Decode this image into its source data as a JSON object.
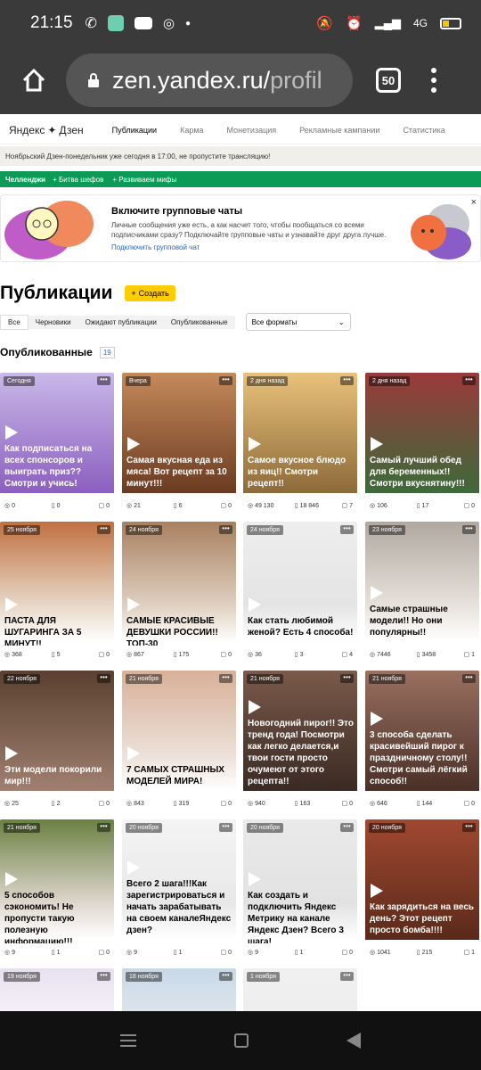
{
  "status": {
    "time": "21:15",
    "network": "4G"
  },
  "browser": {
    "url_main": "zen.yandex.ru/",
    "url_dim": "profil",
    "tabs_count": "50"
  },
  "header": {
    "logo": {
      "left": "Яндекс",
      "right": "Дзен"
    },
    "nav": [
      "Публикации",
      "Карма",
      "Монетизация",
      "Рекламные кампании",
      "Статистика"
    ]
  },
  "announce": "Ноябрьский Дзен-понедельник уже сегодня в 17:00, не пропустите трансляцию!",
  "greenbar": {
    "title": "Челленджи",
    "items": [
      "+ Битва шефов",
      "+ Развиваем мифы"
    ]
  },
  "promo": {
    "title": "Включите групповые чаты",
    "text": "Личные сообщения уже есть, а как насчет того, чтобы пообщаться со всеми подписчиками сразу? Подключайте групповые чаты и узнавайте друг друга лучше.",
    "link": "Подключить групповой чат",
    "close": "×"
  },
  "publications": {
    "title": "Публикации",
    "create": "Создать",
    "filters": [
      "Все",
      "Черновики",
      "Ожидают публикации",
      "Опубликованные"
    ],
    "format": "Все форматы",
    "published_label": "Опубликованные",
    "published_count": "19"
  },
  "cards": [
    {
      "date": "Сегодня",
      "title": "Как подписаться на всех спонсоров и выиграть приз?? Смотри и учись!",
      "views": "0",
      "reads": "0",
      "comments": "0",
      "dark": true,
      "color1": "#c9b8e8",
      "color2": "#8c5fbf"
    },
    {
      "date": "Вчера",
      "title": "Самая вкусная еда из мяса! Вот рецепт за 10 минут!!!",
      "views": "21",
      "reads": "6",
      "comments": "0",
      "dark": true,
      "color1": "#c58a5a",
      "color2": "#6b3b22"
    },
    {
      "date": "2 дня назад",
      "title": "Самое вкусное блюдо из яиц!! Смотри рецепт!!",
      "views": "49 130",
      "reads": "18 846",
      "comments": "7",
      "dark": true,
      "color1": "#e9c27a",
      "color2": "#8d6a3a"
    },
    {
      "date": "2 дня назад",
      "title": "Самый лучший обед для беременных!! Смотри вкуснятину!!!",
      "views": "106",
      "reads": "17",
      "comments": "0",
      "dark": true,
      "color1": "#9a3a3a",
      "color2": "#3d6a3a"
    },
    {
      "date": "25 ноября",
      "title": "ПАСТА ДЛЯ ШУГАРИНГА ЗА 5 МИНУТ!!",
      "views": "368",
      "reads": "5",
      "comments": "0",
      "dark": false,
      "color1": "#c07040",
      "color2": "#e8d8c8"
    },
    {
      "date": "24 ноября",
      "title": "САМЫЕ КРАСИВЫЕ ДЕВУШКИ РОССИИ!! ТОП-30",
      "views": "867",
      "reads": "175",
      "comments": "0",
      "dark": false,
      "color1": "#a88060",
      "color2": "#e0d0c0"
    },
    {
      "date": "24 ноября",
      "title": "Как стать любимой женой? Есть 4 способа!",
      "views": "36",
      "reads": "3",
      "comments": "4",
      "dark": false,
      "color1": "#eeeeee",
      "color2": "#e4e4e4"
    },
    {
      "date": "23 ноября",
      "title": "Самые страшные модели!! Но они популярны!!",
      "views": "7446",
      "reads": "3458",
      "comments": "1",
      "dark": false,
      "color1": "#b0a8a0",
      "color2": "#e8e2dc"
    },
    {
      "date": "22 ноября",
      "title": "Эти модели покорили мир!!!",
      "views": "25",
      "reads": "2",
      "comments": "0",
      "dark": true,
      "color1": "#5a4030",
      "color2": "#a08070"
    },
    {
      "date": "21 ноября",
      "title": "7 САМЫХ СТРАШНЫХ МОДЕЛЕЙ МИРА!",
      "views": "843",
      "reads": "319",
      "comments": "0",
      "dark": false,
      "color1": "#d8b098",
      "color2": "#ece0d8"
    },
    {
      "date": "21 ноября",
      "title": "Новогодний пирог!! Это тренд года! Посмотри как легко делается,и твои гости просто очумеют от этого рецепта!!",
      "views": "940",
      "reads": "163",
      "comments": "0",
      "dark": true,
      "color1": "#7a5a4a",
      "color2": "#3a2a24"
    },
    {
      "date": "21 ноября",
      "title": "3 способа сделать красивейший пирог к праздничному столу!! Смотри самый лёгкий способ!!",
      "views": "646",
      "reads": "144",
      "comments": "0",
      "dark": true,
      "color1": "#9a7060",
      "color2": "#4a3028"
    },
    {
      "date": "21 ноября",
      "title": "5 способов сэкономить! Не пропусти такую полезную информацию!!!",
      "views": "9",
      "reads": "1",
      "comments": "0",
      "dark": false,
      "color1": "#6a8040",
      "color2": "#e0d8d0"
    },
    {
      "date": "20 ноября",
      "title": "Всего 2 шага!!!Как зарегистрироваться и начать зарабатывать на своем каналеЯндекс дзен?",
      "views": "9",
      "reads": "1",
      "comments": "0",
      "dark": false,
      "color1": "#f4f4f4",
      "color2": "#e8e8e8"
    },
    {
      "date": "20 ноября",
      "title": "Как создать и подключить Яндекс Метрику на канале Яндекс Дзен? Всего 3 шага!",
      "views": "9",
      "reads": "1",
      "comments": "0",
      "dark": false,
      "color1": "#eaeaea",
      "color2": "#e2e2e2"
    },
    {
      "date": "20 ноября",
      "title": "Как зарядиться на весь день? Этот рецепт просто бомба!!!!",
      "views": "1041",
      "reads": "215",
      "comments": "1",
      "dark": true,
      "color1": "#a04830",
      "color2": "#5a2a1a"
    },
    {
      "date": "19 ноября",
      "title": "",
      "views": "",
      "reads": "",
      "comments": "",
      "dark": false,
      "color1": "#e8e0f0",
      "color2": "#ffffff"
    },
    {
      "date": "18 ноября",
      "title": "",
      "views": "",
      "reads": "",
      "comments": "",
      "dark": false,
      "color1": "#c8d8e8",
      "color2": "#f0f0f0"
    },
    {
      "date": "1 ноября",
      "title": "",
      "views": "",
      "reads": "",
      "comments": "",
      "dark": false,
      "color1": "#f0f0f0",
      "color2": "#ececec"
    }
  ]
}
